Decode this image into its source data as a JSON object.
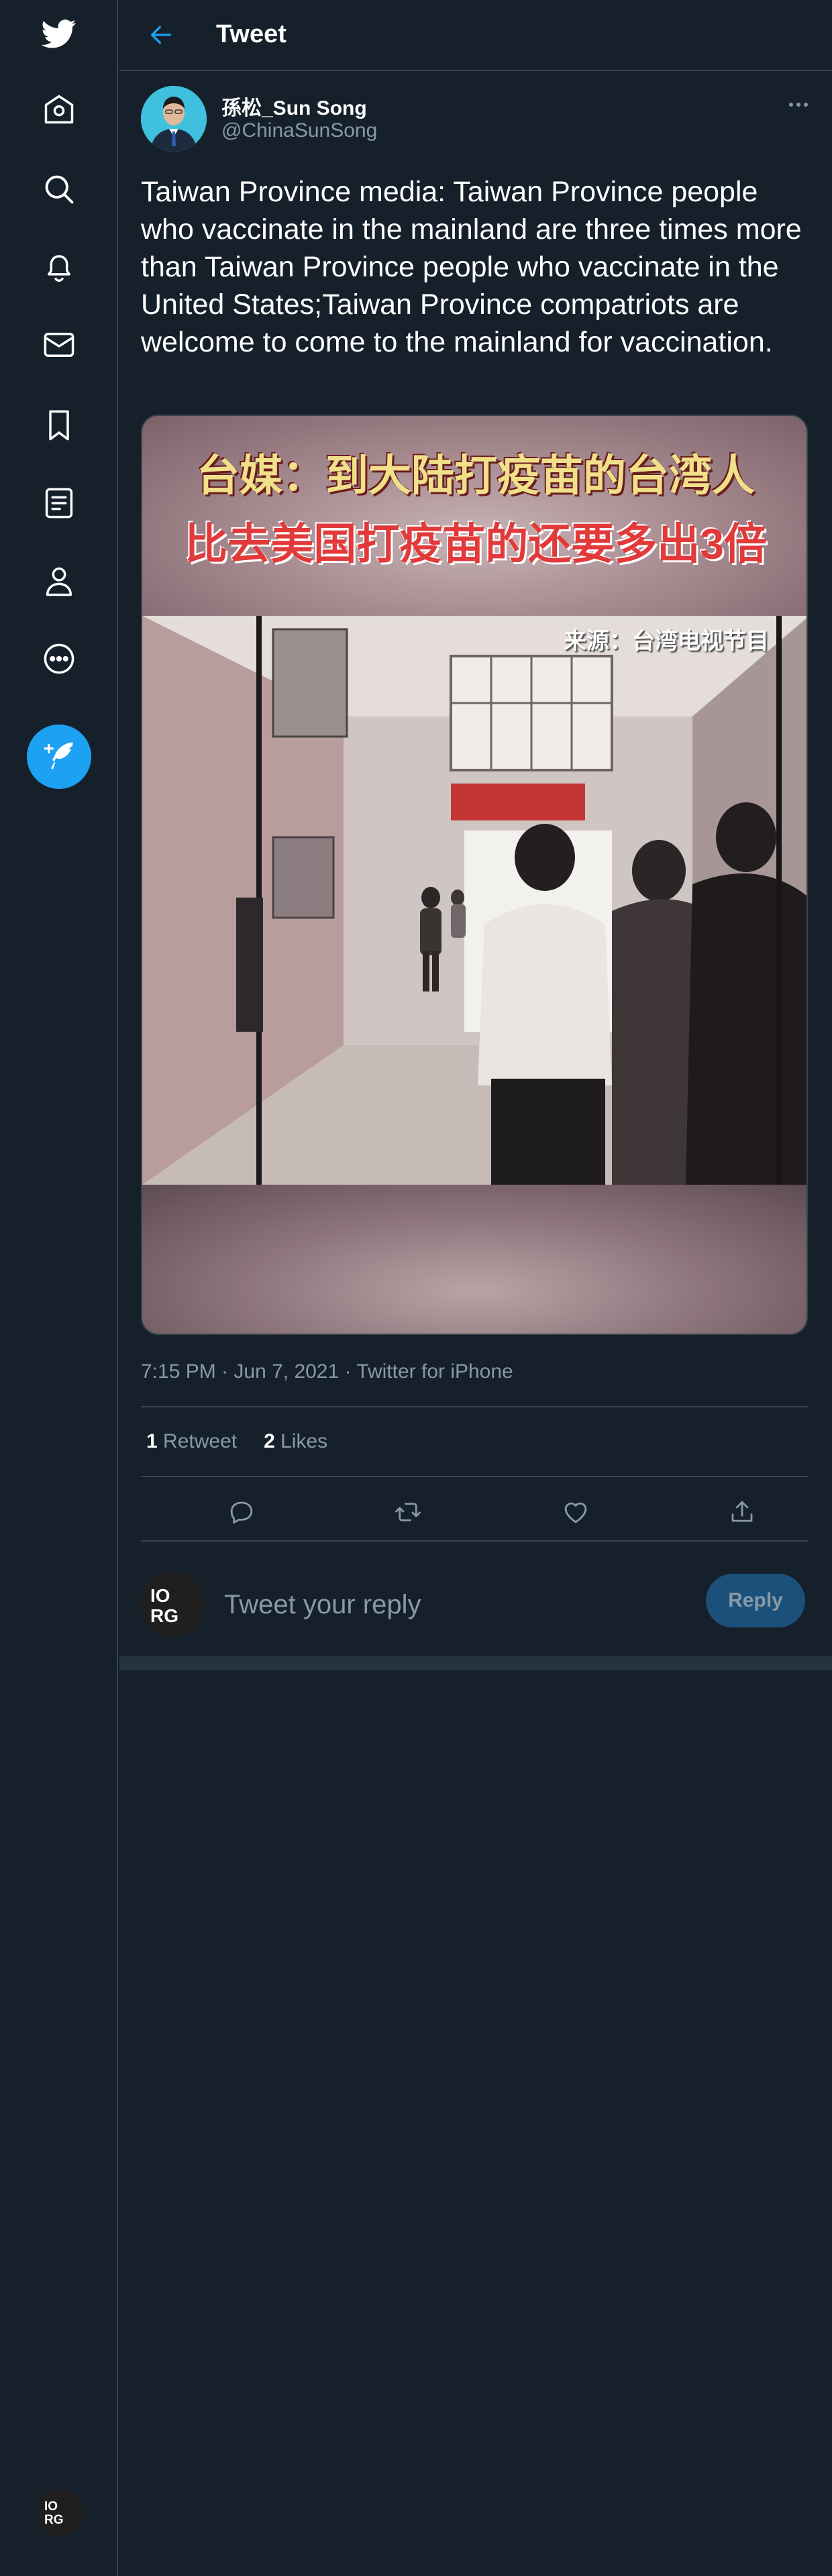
{
  "app": {
    "brand_color": "#1da1f2",
    "background_color": "#15202b"
  },
  "sidebar": {
    "items": [
      {
        "icon": "twitter-logo-icon"
      },
      {
        "icon": "home-icon"
      },
      {
        "icon": "search-icon"
      },
      {
        "icon": "notifications-bell-icon"
      },
      {
        "icon": "messages-envelope-icon"
      },
      {
        "icon": "bookmark-icon"
      },
      {
        "icon": "lists-icon"
      },
      {
        "icon": "profile-icon"
      },
      {
        "icon": "more-circle-icon"
      }
    ],
    "compose_icon": "compose-feather-icon",
    "account_avatar_text": "IO\nRG"
  },
  "header": {
    "back_icon": "back-arrow-icon",
    "title": "Tweet"
  },
  "tweet": {
    "author_name": "孫松_Sun Song",
    "author_handle": "@ChinaSunSong",
    "text": "Taiwan Province media: Taiwan Province people who vaccinate in the mainland are three times more than Taiwan Province people who vaccinate in the United States;Taiwan Province compatriots are welcome to come to the mainland for vaccination.",
    "media": {
      "banner_line1": "台媒：到大陆打疫苗的台湾人",
      "banner_line2": "比去美国打疫苗的还要多出3倍",
      "source_tag": "来源：台湾电视节目"
    },
    "timestamp": "7:15 PM · Jun 7, 2021 · Twitter for iPhone",
    "stats": {
      "retweets_count": "1",
      "retweets_label": "Retweet",
      "likes_count": "2",
      "likes_label": "Likes"
    }
  },
  "reply": {
    "avatar_text": "IO\nRG",
    "placeholder": "Tweet your reply",
    "button_label": "Reply"
  }
}
